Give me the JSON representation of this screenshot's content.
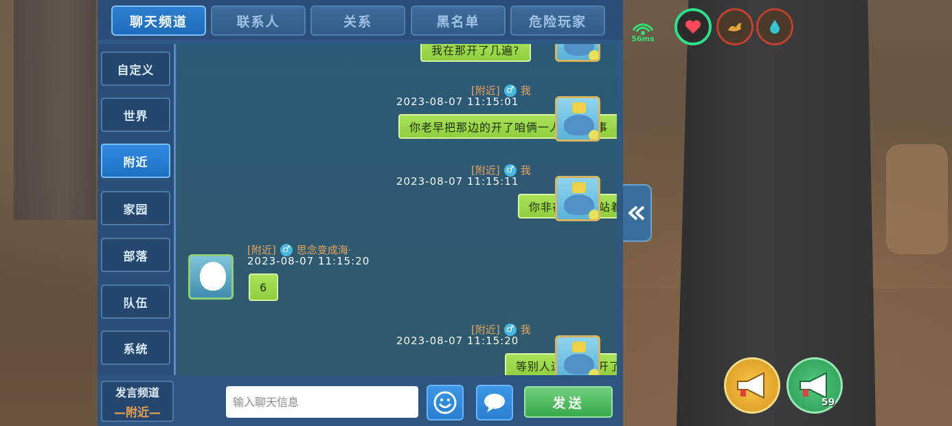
{
  "tabs": [
    "聊天频道",
    "联系人",
    "关系",
    "黑名单",
    "危险玩家"
  ],
  "active_tab": 0,
  "sidebar": {
    "items": [
      "自定义",
      "世界",
      "附近",
      "家园",
      "部落",
      "队伍",
      "系统"
    ],
    "active": 2
  },
  "messages": [
    {
      "text": "我在那开了几遍?"
    },
    {
      "channel": "[附近]",
      "gender": "♂",
      "sender": "我",
      "time": "2023-08-07  11:15:01",
      "text": "你老早把那边的开了咱俩一人一个完事"
    },
    {
      "channel": "[附近]",
      "gender": "♂",
      "sender": "我",
      "time": "2023-08-07  11:15:11",
      "text": "你非在台子那站着"
    },
    {
      "channel": "[附近]",
      "gender": "♂",
      "sender": "思念变成海·",
      "time": "2023-08-07  11:15:20",
      "text": "6"
    },
    {
      "channel": "[附近]",
      "gender": "♂",
      "sender": "我",
      "time": "2023-08-07  11:15:20",
      "text": "等别人过来了去开了"
    }
  ],
  "bottom": {
    "channel_label": "发言频道",
    "channel_value": "—附近—",
    "input_placeholder": "输入聊天信息",
    "send_label": "发送"
  },
  "hud": {
    "ping": "56ms",
    "horn_count": "59"
  },
  "colors": {
    "accent": "#2f8ae0",
    "bubble": "#a9e25a",
    "channel_tag": "#f6a25b",
    "send": "#3aa94d"
  },
  "icons": [
    "signal-icon",
    "heart-icon",
    "food-icon",
    "water-drop-icon",
    "collapse-arrow-icon",
    "emoji-icon",
    "speech-bubble-icon",
    "megaphone-icon",
    "microphone-icon"
  ]
}
